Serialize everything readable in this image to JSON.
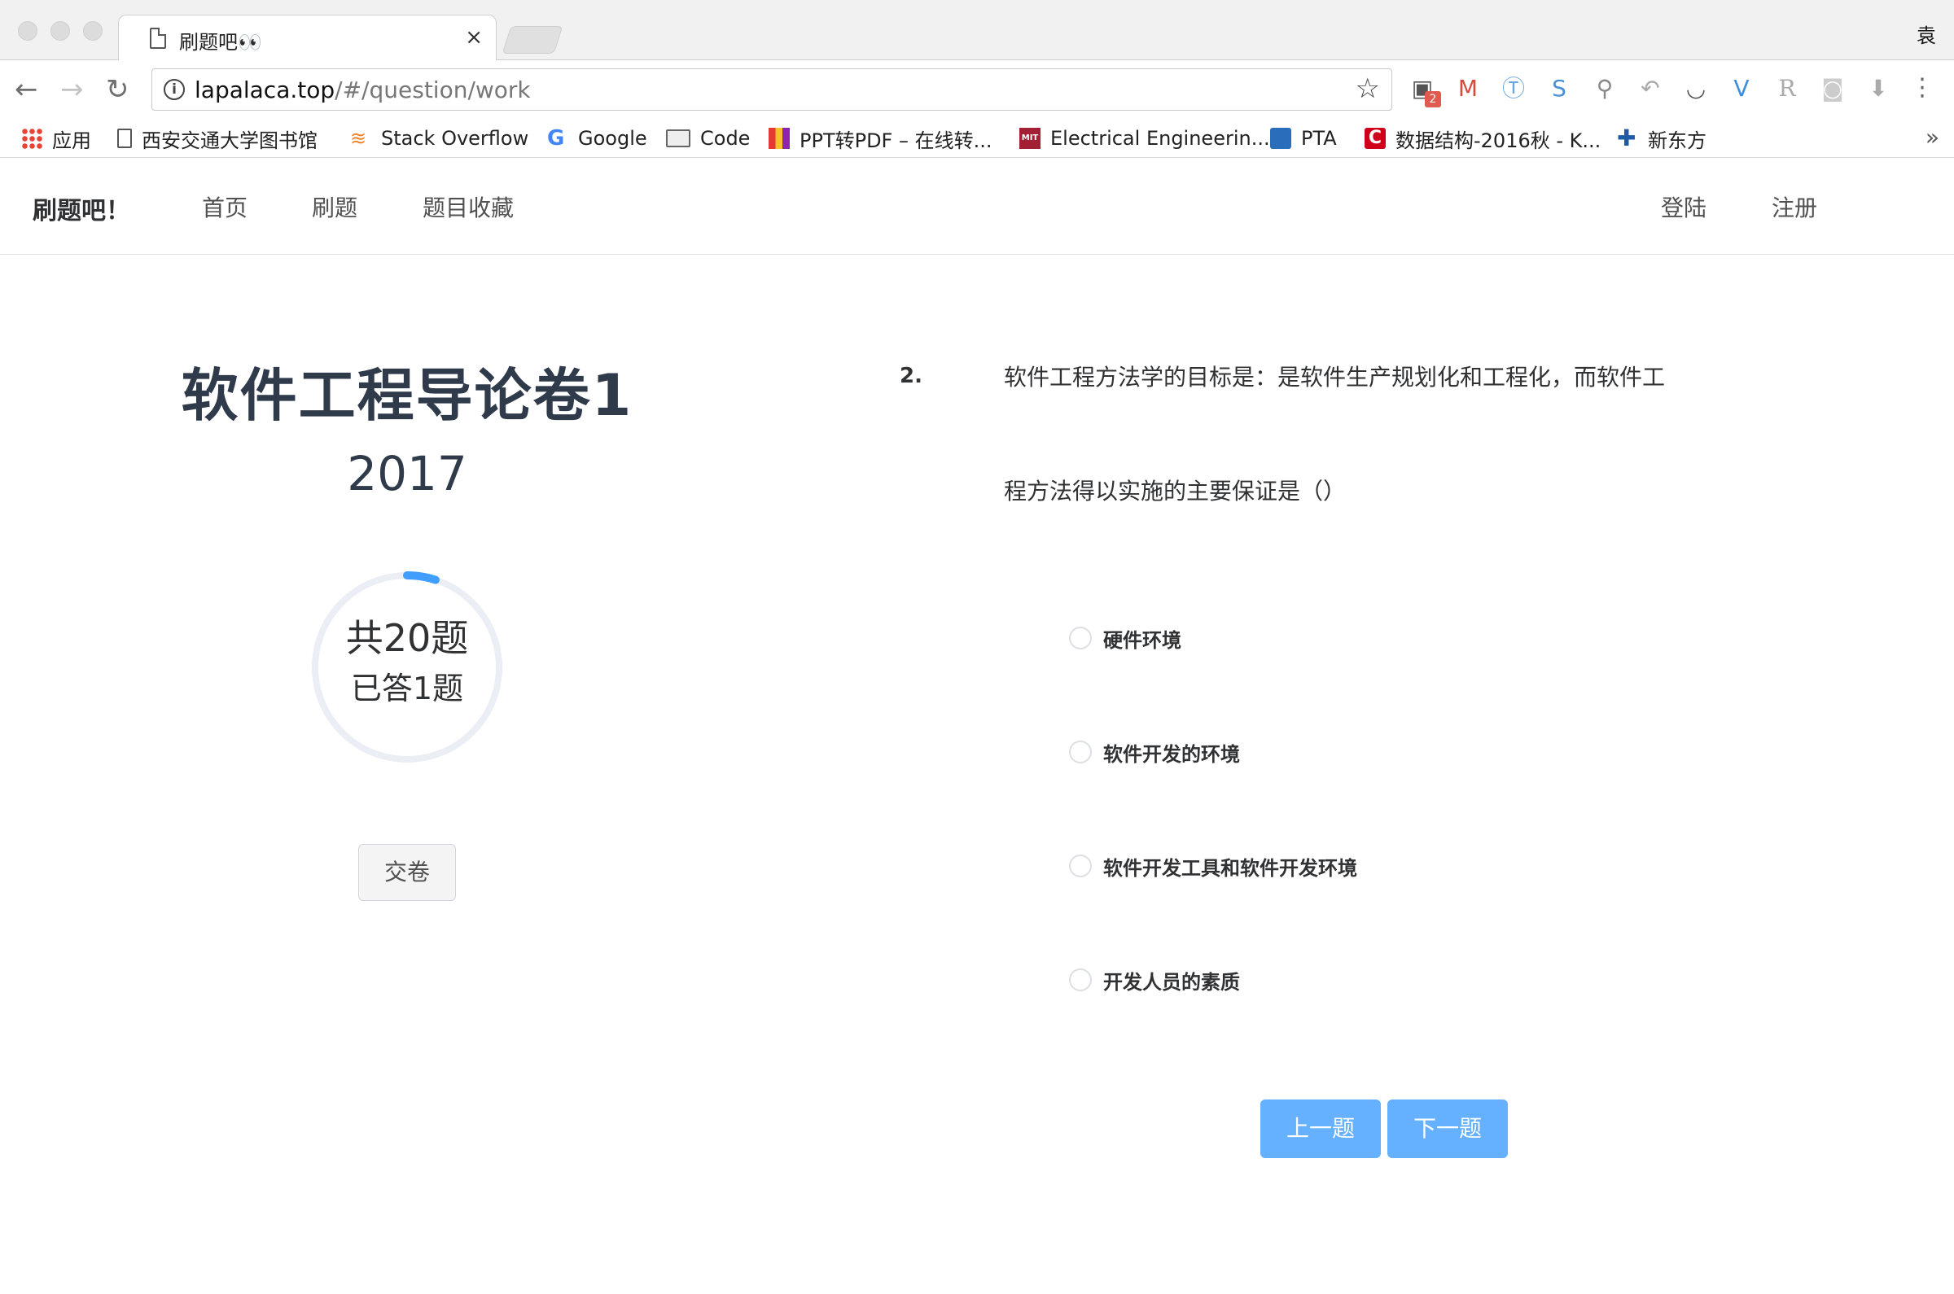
{
  "browser": {
    "tab_title": "刷题吧👀",
    "tab_close": "×",
    "profile_initial": "袁",
    "url_host": "lapalaca.top",
    "url_path": "/#/question/work",
    "bookmarks": [
      {
        "label": "应用",
        "icon": "apps-grid-icon"
      },
      {
        "label": "西安交通大学图书馆",
        "icon": "page-icon"
      },
      {
        "label": "Stack Overflow",
        "icon": "stackoverflow-icon"
      },
      {
        "label": "Google",
        "icon": "google-icon"
      },
      {
        "label": "Code",
        "icon": "folder-icon"
      },
      {
        "label": "PPT转PDF – 在线转...",
        "icon": "ppt-pdf-icon"
      },
      {
        "label": "Electrical Engineerin...",
        "icon": "mit-ocw-icon"
      },
      {
        "label": "PTA",
        "icon": "pta-icon"
      },
      {
        "label": "数据结构-2016秋 - K...",
        "icon": "c-icon"
      },
      {
        "label": "新东方",
        "icon": "xdf-icon"
      }
    ],
    "bookmarks_more": "»",
    "extension_badge": "2"
  },
  "site": {
    "brand": "刷题吧！",
    "nav": [
      "首页",
      "刷题",
      "题目收藏"
    ],
    "login": "登陆",
    "register": "注册"
  },
  "exam": {
    "title": "软件工程导论卷1",
    "year": "2017",
    "total_text": "共20题",
    "answered_text": "已答1题",
    "answered": 1,
    "total": 20,
    "progress_fraction": 0.05,
    "submit_label": "交卷"
  },
  "question": {
    "number": "2.",
    "text_line1": "软件工程方法学的目标是：是软件生产规划化和工程化，而软件工",
    "text_line2": "程方法得以实施的主要保证是（）",
    "options": [
      "硬件环境",
      "软件开发的环境",
      "软件开发工具和软件开发环境",
      "开发人员的素质"
    ]
  },
  "pager": {
    "prev_label": "上一题",
    "next_label": "下一题"
  },
  "colors": {
    "progress_track": "#ebeef5",
    "progress_bar": "#409eff",
    "pager_button": "#66b1ff"
  }
}
